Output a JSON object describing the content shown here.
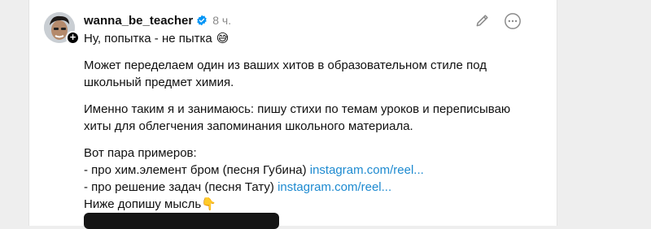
{
  "post": {
    "username": "wanna_be_teacher",
    "time": "8 ч.",
    "verified_icon": "verified-badge-icon",
    "line1": "Ну, попытка - не пытка",
    "line1_emoji": "😅",
    "para2_line1": "Может переделаем один из ваших хитов в образовательном стиле под",
    "para2_line2": "школьный предмет химия.",
    "para3_line1": "Именно таким я и занимаюсь: пишу стихи по темам уроков и переписываю",
    "para3_line2": "хиты для облегчения запоминания школьного материала.",
    "examples_intro": "Вот пара примеров:",
    "example1_text": "- про хим.элемент бром (песня Губина) ",
    "example1_link": "instagram.com/reel...",
    "example2_text": "- про решение задач (песня Тату) ",
    "example2_link": "instagram.com/reel...",
    "closing": "Ниже допишу мысль",
    "closing_emoji": "👇"
  },
  "icons": {
    "edit": "pencil-icon",
    "more": "more-options-icon",
    "follow": "plus-icon"
  },
  "colors": {
    "link": "#1d8ad0",
    "verified": "#0095f6",
    "time": "#8a8a8a"
  }
}
